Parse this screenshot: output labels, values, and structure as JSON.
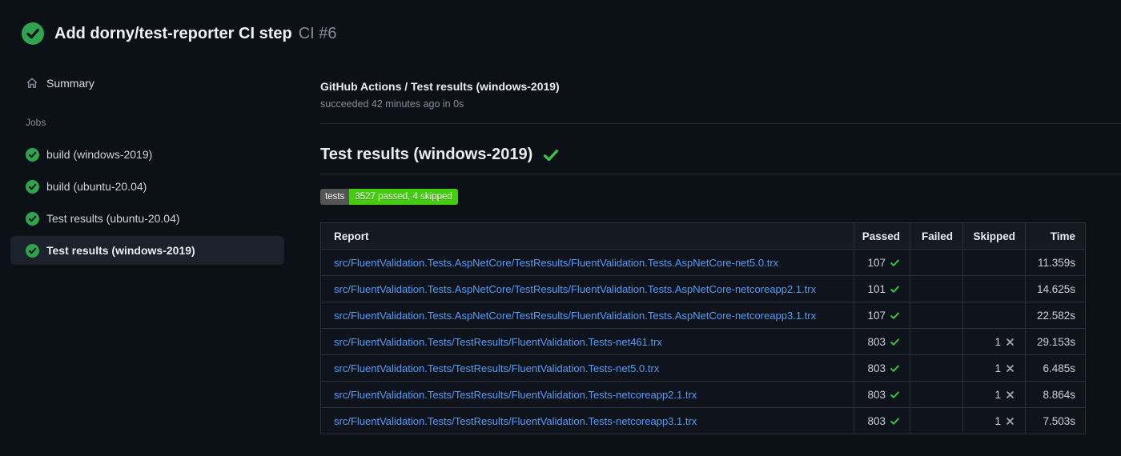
{
  "header": {
    "title": "Add dorny/test-reporter CI step",
    "run_number": "CI #6"
  },
  "sidebar": {
    "summary_label": "Summary",
    "jobs_section_label": "Jobs",
    "jobs": [
      {
        "label": "build (windows-2019)",
        "status": "success",
        "selected": false
      },
      {
        "label": "build (ubuntu-20.04)",
        "status": "success",
        "selected": false
      },
      {
        "label": "Test results (ubuntu-20.04)",
        "status": "success",
        "selected": false
      },
      {
        "label": "Test results (windows-2019)",
        "status": "success",
        "selected": true
      }
    ]
  },
  "main": {
    "check_title": "GitHub Actions / Test results (windows-2019)",
    "status_line": "succeeded 42 minutes ago in 0s",
    "heading": "Test results (windows-2019)",
    "badge": {
      "label": "tests",
      "value": "3527 passed, 4 skipped"
    },
    "table": {
      "columns": [
        "Report",
        "Passed",
        "Failed",
        "Skipped",
        "Time"
      ],
      "rows": [
        {
          "report": "src/FluentValidation.Tests.AspNetCore/TestResults/FluentValidation.Tests.AspNetCore-net5.0.trx",
          "passed": "107",
          "failed": "",
          "skipped": "",
          "time": "11.359s"
        },
        {
          "report": "src/FluentValidation.Tests.AspNetCore/TestResults/FluentValidation.Tests.AspNetCore-netcoreapp2.1.trx",
          "passed": "101",
          "failed": "",
          "skipped": "",
          "time": "14.625s"
        },
        {
          "report": "src/FluentValidation.Tests.AspNetCore/TestResults/FluentValidation.Tests.AspNetCore-netcoreapp3.1.trx",
          "passed": "107",
          "failed": "",
          "skipped": "",
          "time": "22.582s"
        },
        {
          "report": "src/FluentValidation.Tests/TestResults/FluentValidation.Tests-net461.trx",
          "passed": "803",
          "failed": "",
          "skipped": "1",
          "time": "29.153s"
        },
        {
          "report": "src/FluentValidation.Tests/TestResults/FluentValidation.Tests-net5.0.trx",
          "passed": "803",
          "failed": "",
          "skipped": "1",
          "time": "6.485s"
        },
        {
          "report": "src/FluentValidation.Tests/TestResults/FluentValidation.Tests-netcoreapp2.1.trx",
          "passed": "803",
          "failed": "",
          "skipped": "1",
          "time": "8.864s"
        },
        {
          "report": "src/FluentValidation.Tests/TestResults/FluentValidation.Tests-netcoreapp3.1.trx",
          "passed": "803",
          "failed": "",
          "skipped": "1",
          "time": "7.503s"
        }
      ]
    }
  },
  "colors": {
    "bg": "#0c1017",
    "border": "#2b313b",
    "link": "#539bf5",
    "green-circle": "#2ea44f",
    "green-check": "#34c744",
    "x-gray": "#9aa2ac",
    "badge-label": "#555555",
    "badge-value": "#44cc11",
    "selected": "#1c222c"
  }
}
